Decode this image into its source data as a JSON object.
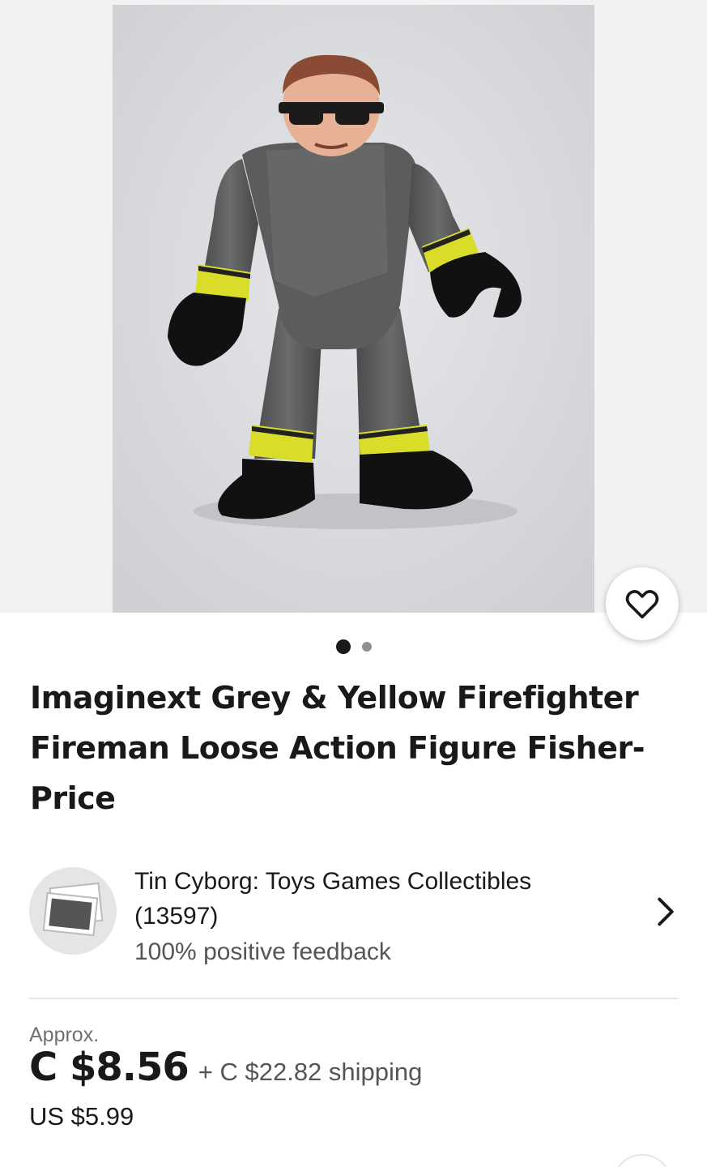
{
  "gallery": {
    "image_alt": "Imaginext grey and yellow firefighter action figure",
    "total_images": 2,
    "current_index": 1
  },
  "listing": {
    "title": "Imaginext Grey & Yellow Firefighter Fireman Loose Action Figure Fisher-Price"
  },
  "seller": {
    "name": "Tin Cyborg: Toys Games Collectibles",
    "feedback_count": "(13597)",
    "feedback_text": "100% positive feedback"
  },
  "price": {
    "approx_label": "Approx.",
    "main": "C $8.56",
    "shipping": "+ C $22.82 shipping",
    "original": "US $5.99"
  },
  "colors": {
    "text_primary": "#191919",
    "text_secondary": "#555555",
    "figure_grey": "#5b5d5c",
    "figure_yellow": "#d9dd2a"
  }
}
